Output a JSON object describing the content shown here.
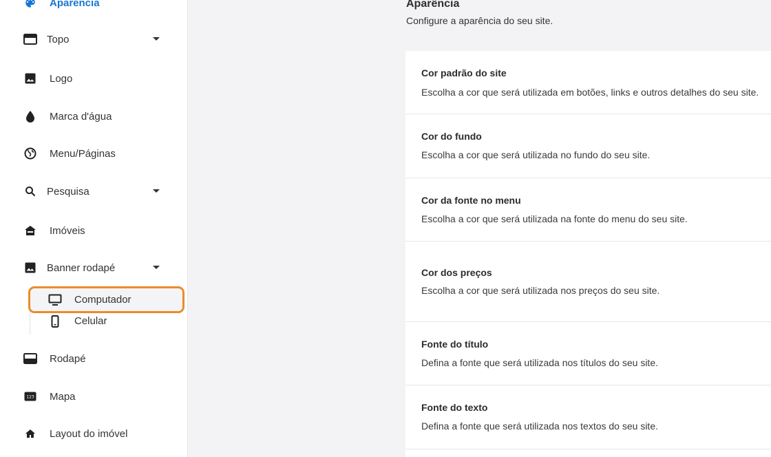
{
  "sidebar": {
    "items": [
      {
        "label": "Aparência",
        "icon": "palette-icon"
      },
      {
        "label": "Topo",
        "icon": "header-icon"
      },
      {
        "label": "Logo",
        "icon": "image-icon"
      },
      {
        "label": "Marca d'água",
        "icon": "water-drop-icon"
      },
      {
        "label": "Menu/Páginas",
        "icon": "globe-icon"
      },
      {
        "label": "Pesquisa",
        "icon": "search-icon"
      },
      {
        "label": "Imóveis",
        "icon": "house-icon"
      },
      {
        "label": "Banner rodapé",
        "icon": "image-icon"
      },
      {
        "label": "Rodapé",
        "icon": "footer-icon"
      },
      {
        "label": "Mapa",
        "icon": "map-123-icon"
      },
      {
        "label": "Layout do imóvel",
        "icon": "home-icon"
      }
    ],
    "banner_sub": [
      {
        "label": "Computador",
        "icon": "desktop-icon"
      },
      {
        "label": "Celular",
        "icon": "mobile-icon"
      }
    ]
  },
  "main": {
    "title": "Aparência",
    "subtitle": "Configure a aparência do seu site.",
    "cards": [
      {
        "title": "Cor padrão do site",
        "description": "Escolha a cor que será utilizada em botões, links e outros detalhes do seu site."
      },
      {
        "title": "Cor do fundo",
        "description": "Escolha a cor que será utilizada no fundo do seu site."
      },
      {
        "title": "Cor da fonte no menu",
        "description": "Escolha a cor que será utilizada na fonte do menu do seu site."
      },
      {
        "title": "Cor dos preços",
        "description": "Escolha a cor que será utilizada nos preços do seu site."
      },
      {
        "title": "Fonte do título",
        "description": "Defina a fonte que será utilizada nos títulos do seu site."
      },
      {
        "title": "Fonte do texto",
        "description": "Defina a fonte que será utilizada nos textos do seu site."
      }
    ]
  },
  "colors": {
    "accent": "#1976d2",
    "highlight": "#ec8b2b",
    "background": "#f3f3f5"
  }
}
